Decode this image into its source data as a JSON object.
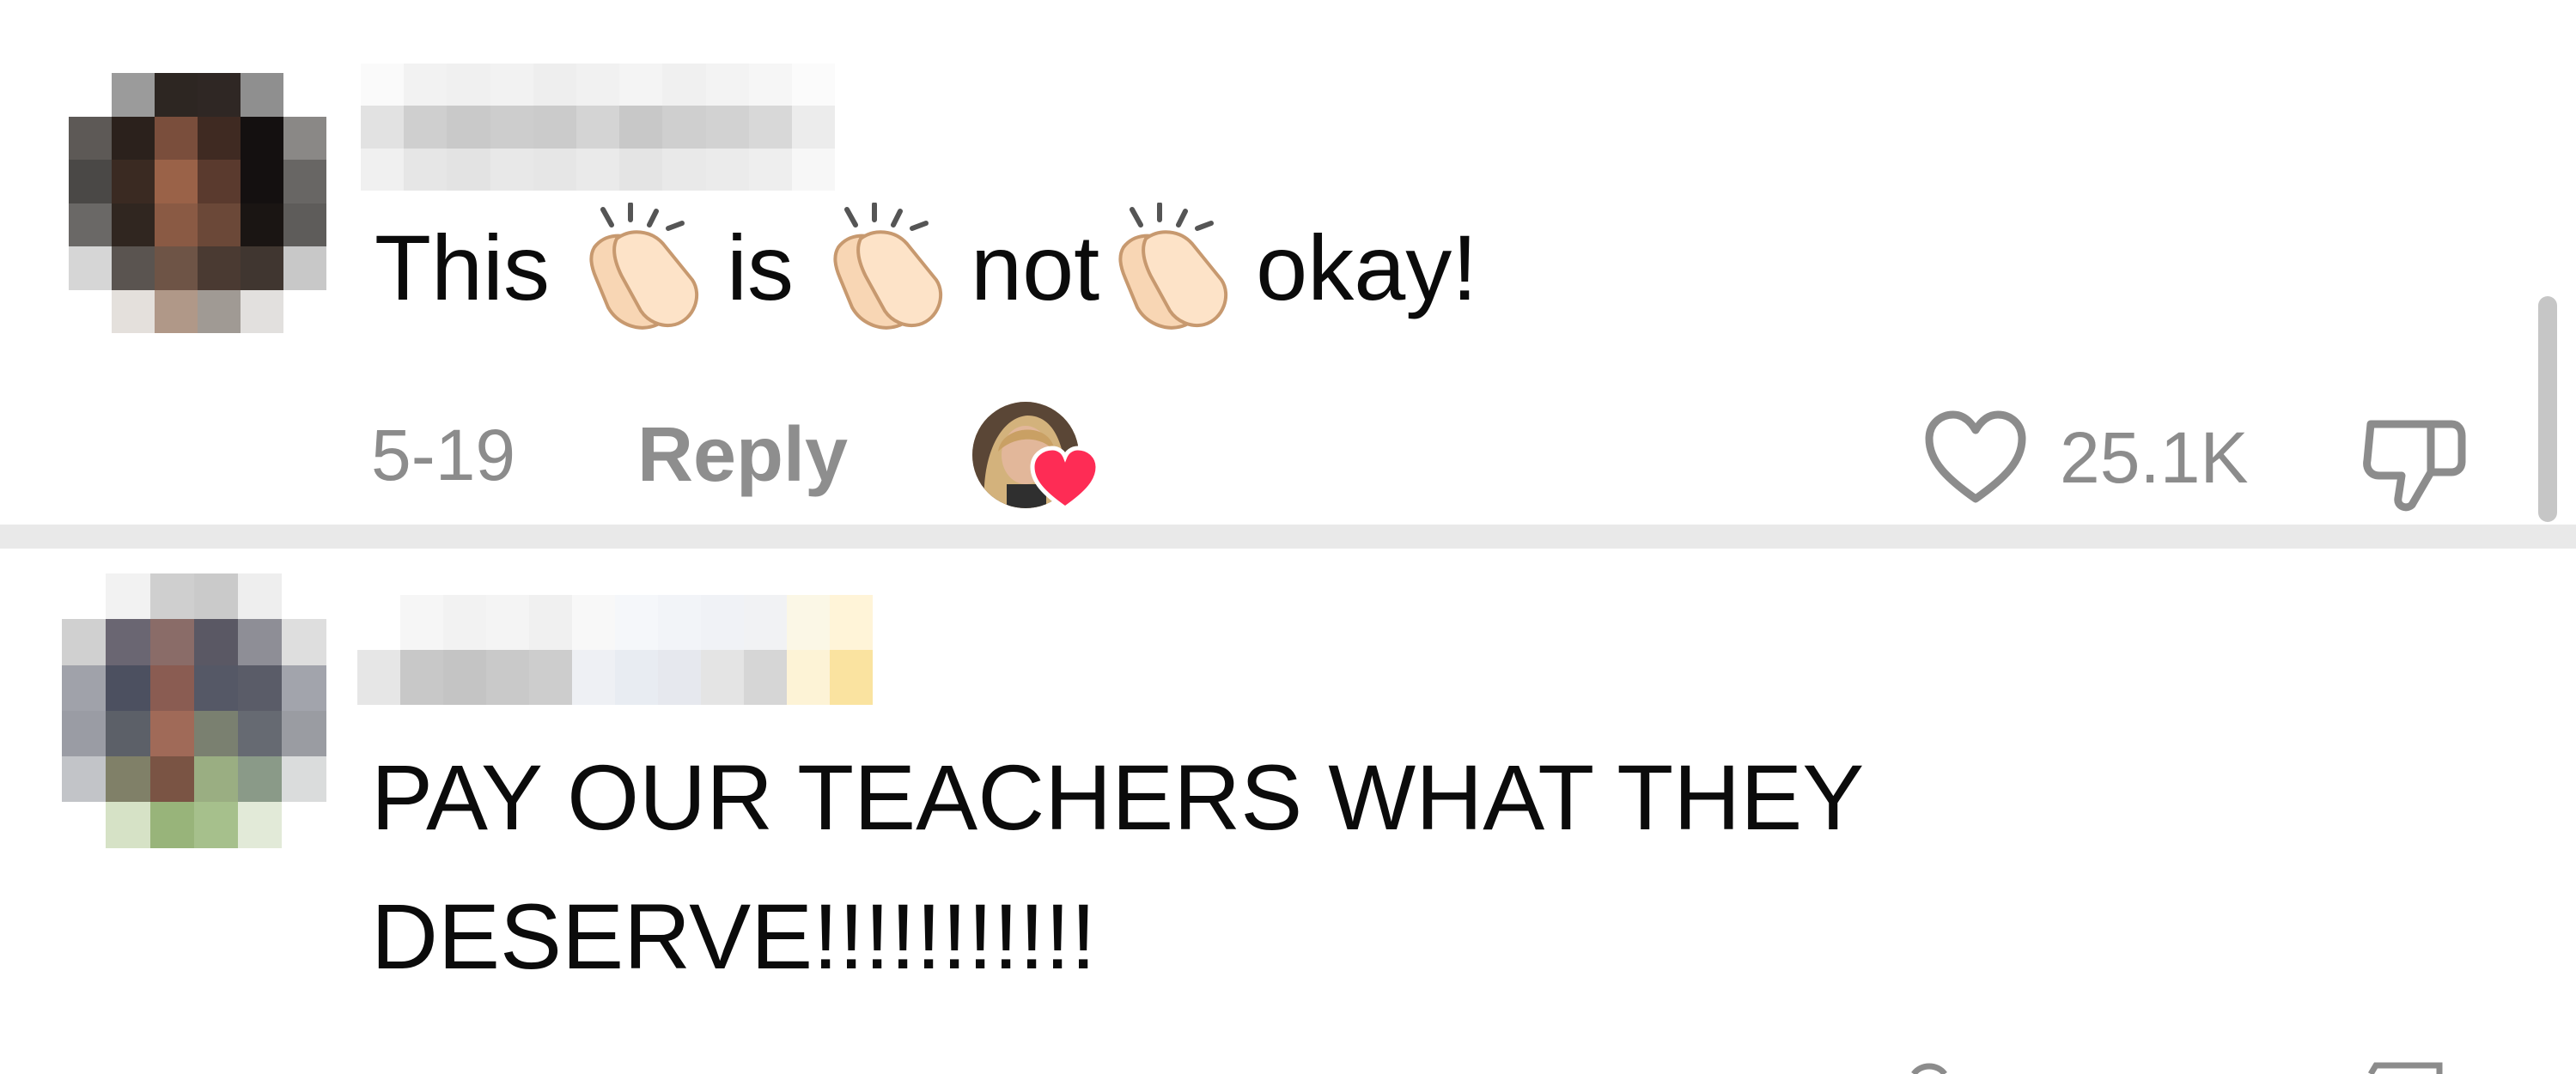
{
  "comments": [
    {
      "avatar": "pixelated-avatar-1",
      "username_visible": false,
      "words": [
        "This",
        "is",
        "not",
        "okay!"
      ],
      "emoji": "clapping-hands",
      "date": "5-19",
      "reply_label": "Reply",
      "creator_liked": true,
      "like_count": "25.1K",
      "icons": {
        "like": "heart-outline-icon",
        "dislike": "thumbs-down-icon",
        "creator_badge": "heart-icon"
      }
    },
    {
      "avatar": "pixelated-avatar-2",
      "username_visible": false,
      "text": "PAY OUR TEACHERS WHAT THEY DESERVE!!!!!!!!!!!"
    }
  ],
  "colors": {
    "background": "#ffffff",
    "primary_text": "#0b0b0b",
    "secondary_text": "#8c8c8c",
    "heart_badge": "#fe2c55",
    "divider": "#e9e9e9"
  }
}
